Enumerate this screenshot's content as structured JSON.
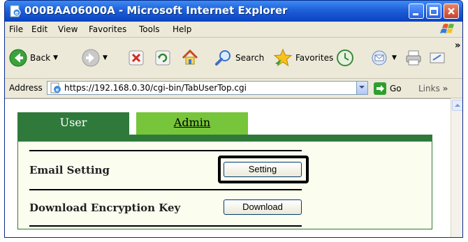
{
  "window": {
    "title": "000BAA06000A - Microsoft Internet Explorer"
  },
  "menubar": {
    "items": [
      "File",
      "Edit",
      "View",
      "Favorites",
      "Tools",
      "Help"
    ]
  },
  "toolbar": {
    "back_label": "Back",
    "search_label": "Search",
    "favorites_label": "Favorites",
    "overflow": "»"
  },
  "addressbar": {
    "label": "Address",
    "url": "https://192.168.0.30/cgi-bin/TabUserTop.cgi",
    "go_label": "Go",
    "links_label": "Links",
    "links_overflow": "»"
  },
  "tabs": {
    "user_label": "User",
    "admin_label": "Admin"
  },
  "rows": [
    {
      "label": "Email Setting",
      "button_label": "Setting",
      "highlighted": true
    },
    {
      "label": "Download Encryption Key",
      "button_label": "Download",
      "highlighted": false
    }
  ],
  "colors": {
    "tab_active": "#2f7a3a",
    "tab_inactive": "#77c53a",
    "panel_bg": "#fbfdef",
    "titlebar": "#1f5fd8"
  }
}
